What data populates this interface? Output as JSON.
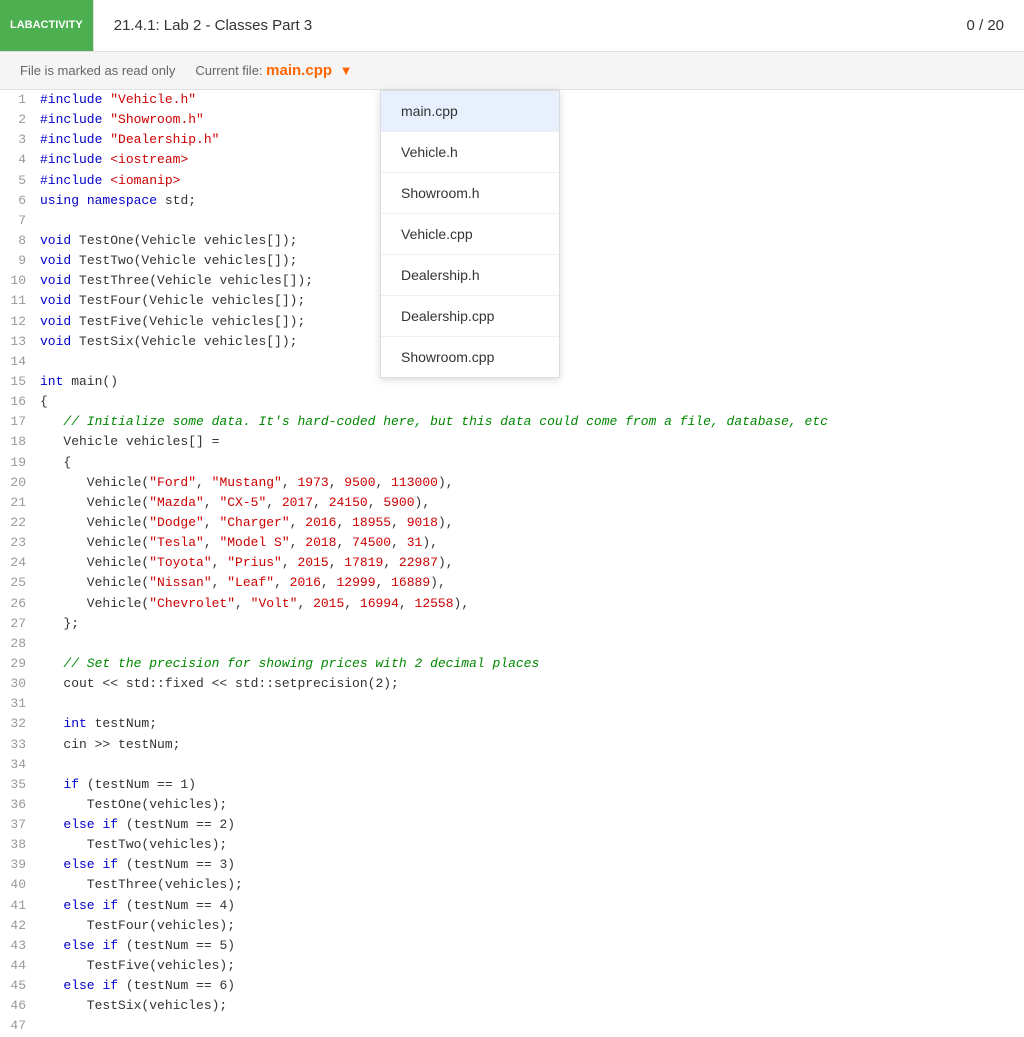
{
  "header": {
    "badge_line1": "LAB",
    "badge_line2": "ACTIVITY",
    "title": "21.4.1: Lab 2 - Classes Part 3",
    "score": "0 / 20"
  },
  "toolbar": {
    "readonly_label": "File is marked as read only",
    "current_file_label": "Current file:",
    "current_file_name": "main.cpp"
  },
  "dropdown": {
    "items": [
      {
        "name": "main.cpp",
        "active": true
      },
      {
        "name": "Vehicle.h",
        "active": false
      },
      {
        "name": "Showroom.h",
        "active": false
      },
      {
        "name": "Vehicle.cpp",
        "active": false
      },
      {
        "name": "Dealership.h",
        "active": false
      },
      {
        "name": "Dealership.cpp",
        "active": false
      },
      {
        "name": "Showroom.cpp",
        "active": false
      }
    ]
  }
}
